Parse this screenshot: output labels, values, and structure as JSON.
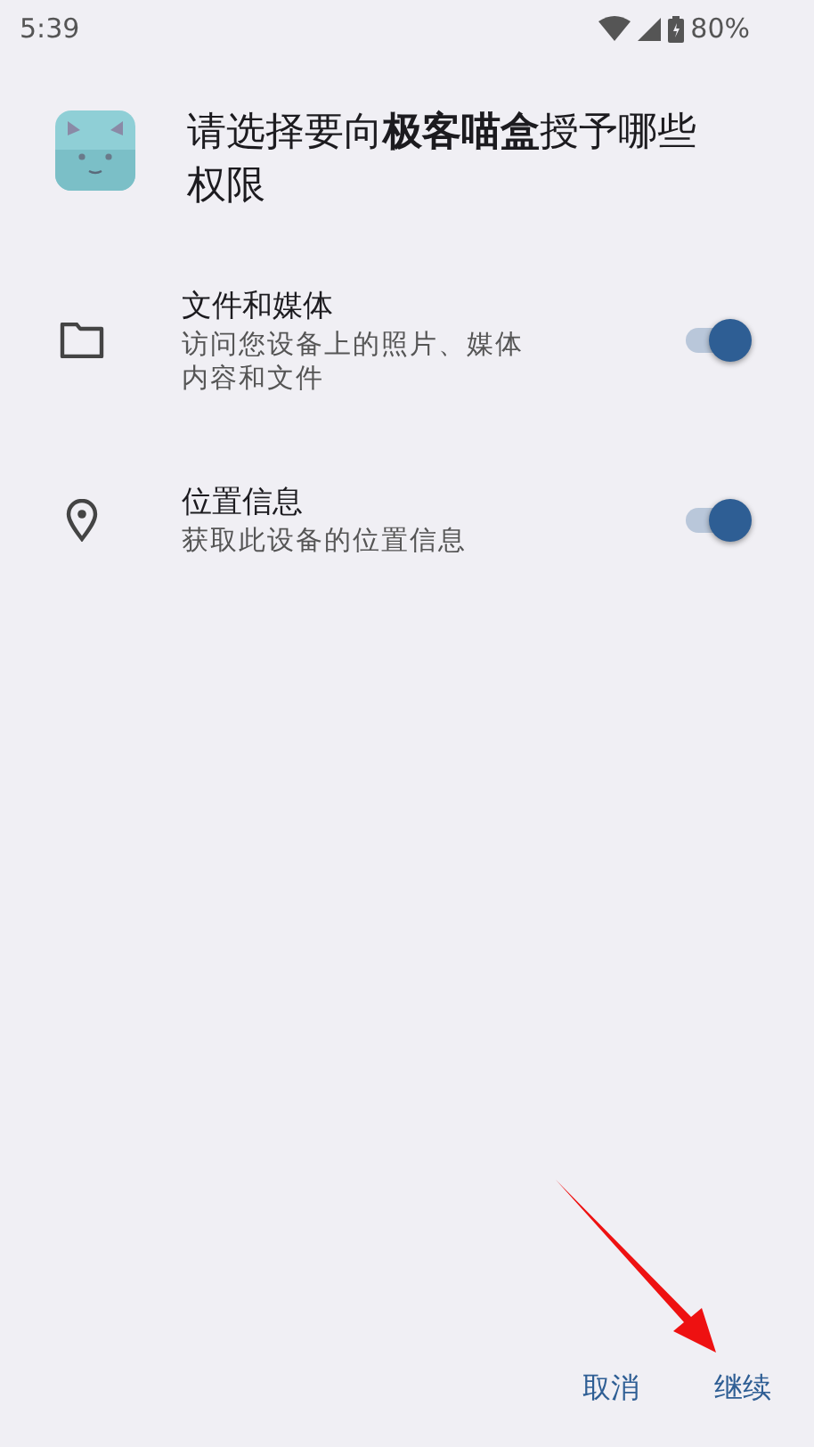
{
  "status_bar": {
    "time": "5:39",
    "battery": "80%"
  },
  "title": "请选择要向**极客喵盒**授予哪些权限",
  "permissions": [
    {
      "kind": "files",
      "title": "文件和媒体",
      "description": "访问您设备上的照片、媒体内容和文件",
      "on": true
    },
    {
      "kind": "location",
      "title": "位置信息",
      "description": "获取此设备的位置信息",
      "on": true
    }
  ],
  "buttons": [
    "取消",
    "继续"
  ]
}
